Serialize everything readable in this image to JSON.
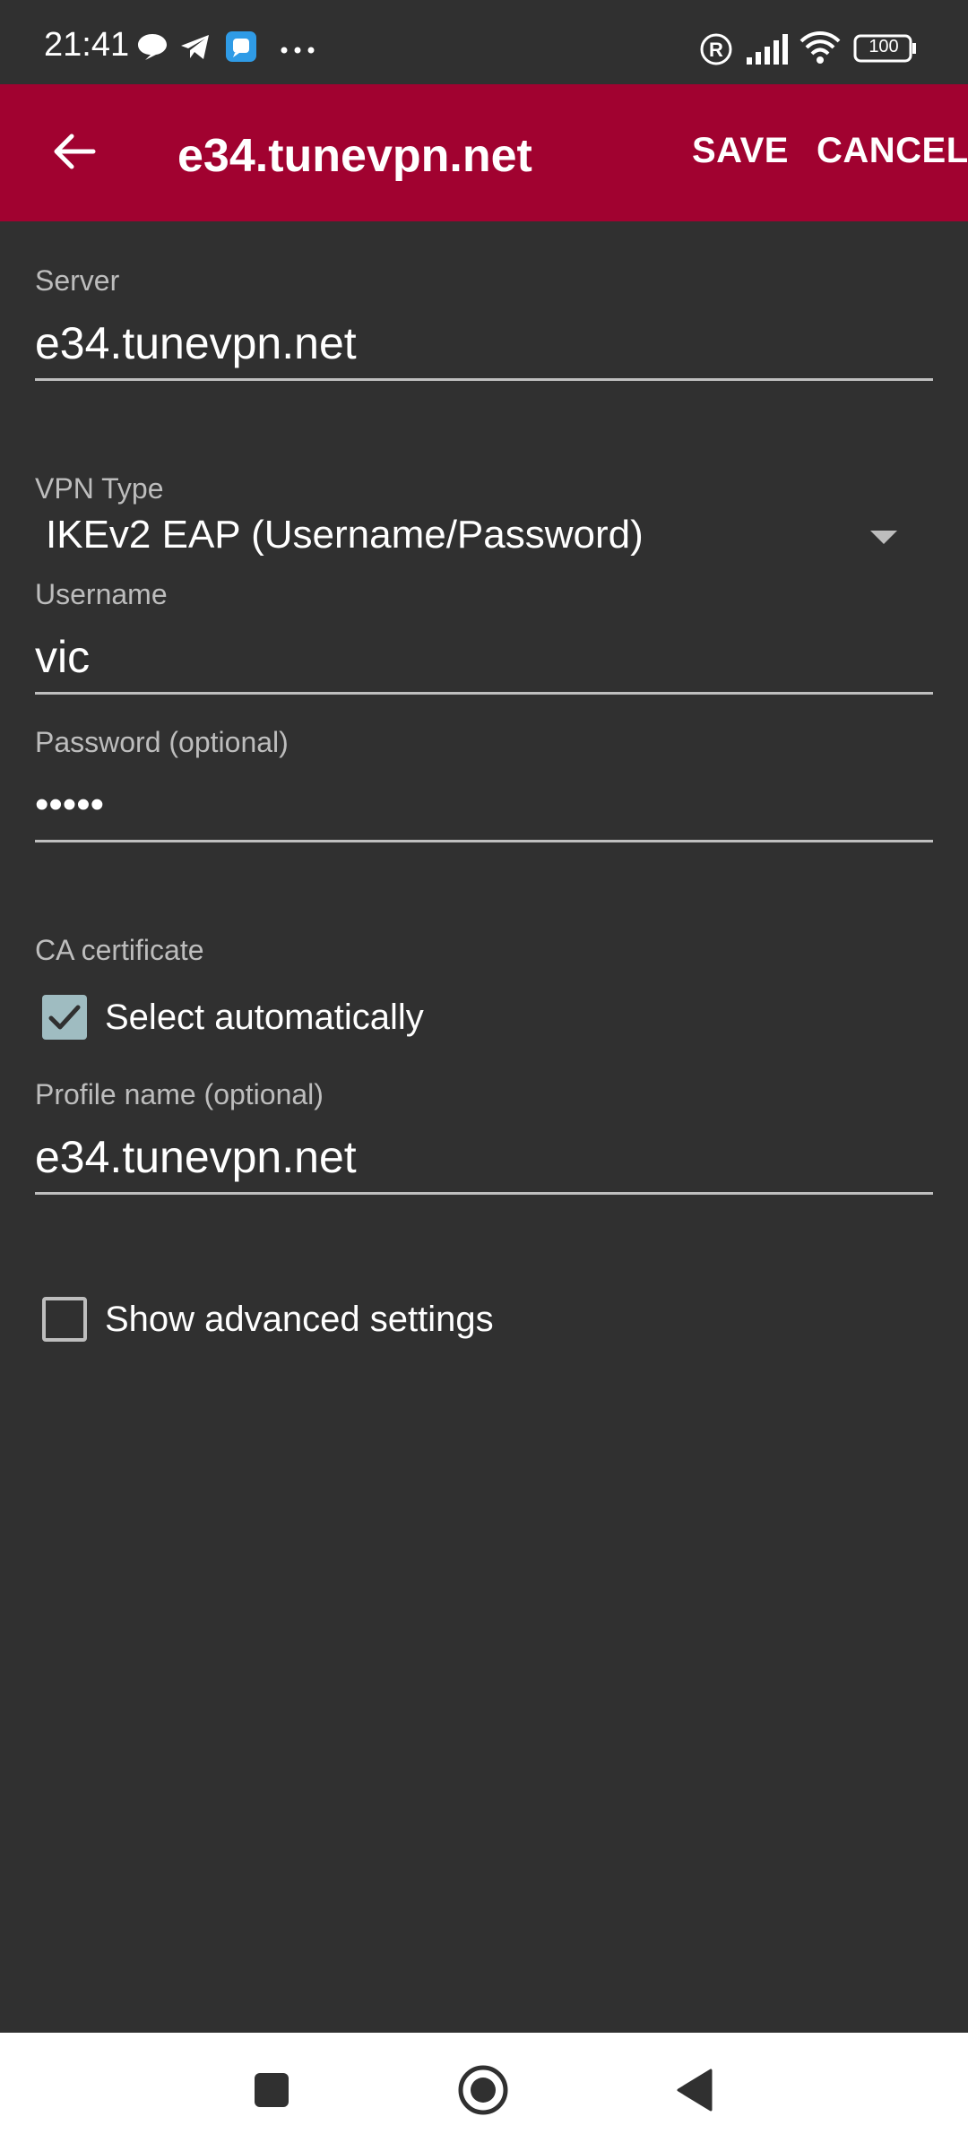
{
  "status_bar": {
    "time": "21:41",
    "icons": [
      "chat-bubble-icon",
      "telegram-icon",
      "app-notification-icon",
      "more-dots-icon",
      "registered-icon",
      "signal-icon",
      "wifi-icon",
      "battery-icon"
    ],
    "battery_level": "100"
  },
  "app_bar": {
    "back_icon": "arrow-back-icon",
    "title": "e34.tunevpn.net",
    "save_label": "SAVE",
    "cancel_label": "CANCEL"
  },
  "form": {
    "server": {
      "label": "Server",
      "value": "e34.tunevpn.net"
    },
    "vpn_type": {
      "label": "VPN Type",
      "value": "IKEv2 EAP (Username/Password)"
    },
    "username": {
      "label": "Username",
      "value": "vic"
    },
    "password": {
      "label": "Password (optional)",
      "value": "•••••"
    },
    "ca_certificate": {
      "label": "CA certificate",
      "checkbox_label": "Select automatically",
      "checked": true
    },
    "profile_name": {
      "label": "Profile name (optional)",
      "value": "e34.tunevpn.net"
    },
    "advanced": {
      "checkbox_label": "Show advanced settings",
      "checked": false
    }
  },
  "nav_bar": {
    "icons": [
      "recents-square-icon",
      "home-circle-icon",
      "back-triangle-icon"
    ]
  },
  "colors": {
    "accent": "#a10230",
    "background": "#303030",
    "checkbox_checked": "#9fbcc1",
    "label": "#bdbdbd",
    "nav_bar": "#ffffff"
  }
}
